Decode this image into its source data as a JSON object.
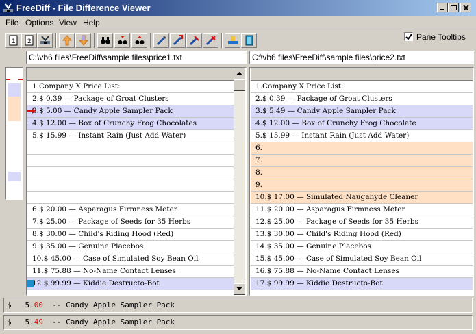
{
  "window": {
    "title": "FreeDiff - File Difference Viewer",
    "controls": {
      "minimize": "minimize-icon",
      "maximize": "maximize-icon",
      "close": "close-icon"
    }
  },
  "menu": [
    "File",
    "Options",
    "View",
    "Help"
  ],
  "toolbar": {
    "buttons": [
      "open-file-1-icon",
      "open-file-2-icon",
      "compare-icon",
      "prev-diff-icon",
      "next-diff-icon",
      "find-icon",
      "find-prev-icon",
      "find-next-icon",
      "tool-a-icon",
      "tool-b-icon",
      "tool-c-icon",
      "tool-d-icon",
      "clear-icon",
      "exit-icon"
    ],
    "pane_tooltips_label": "Pane Tooltips",
    "pane_tooltips_checked": true
  },
  "files": {
    "left_path": "C:\\vb6 files\\FreeDiff\\sample files\\price1.txt",
    "right_path": "C:\\vb6 files\\FreeDiff\\sample files\\price2.txt"
  },
  "colors": {
    "changed": "#d8d8f8",
    "added": "#ffe0c4",
    "marker": "#e01010",
    "accent": "#1890c8"
  },
  "left_pane": {
    "rows": [
      {
        "text": "1.Company X Price List:",
        "state": "same"
      },
      {
        "text": "2.$ 0.39 — Package of Groat Clusters",
        "state": "same"
      },
      {
        "text": "3.$ 5.00 — Candy Apple Sampler Pack",
        "state": "changed",
        "current": true
      },
      {
        "text": "4.$ 12.00 — Box of Crunchy Frog Chocolates",
        "state": "changed"
      },
      {
        "text": "5.$ 15.99 — Instant Rain (Just Add Water)",
        "state": "same"
      },
      {
        "text": "",
        "state": "blank"
      },
      {
        "text": "",
        "state": "blank"
      },
      {
        "text": "",
        "state": "blank"
      },
      {
        "text": "",
        "state": "blank"
      },
      {
        "text": "",
        "state": "blank"
      },
      {
        "text": "6.$ 20.00 — Asparagus Firmness Meter",
        "state": "same"
      },
      {
        "text": "7.$ 25.00 — Package of Seeds for 35 Herbs",
        "state": "same"
      },
      {
        "text": "8.$ 30.00 — Child's Riding Hood (Red)",
        "state": "same"
      },
      {
        "text": "9.$ 35.00 — Genuine Placebos",
        "state": "same"
      },
      {
        "text": "10.$ 45.00 — Case of Simulated Soy Bean Oil",
        "state": "same"
      },
      {
        "text": "11.$ 75.88 — No-Name Contact Lenses",
        "state": "same"
      },
      {
        "text": "12.$ 99.99 — Kiddie Destructo-Bot",
        "state": "changed",
        "mark": true
      }
    ]
  },
  "right_pane": {
    "rows": [
      {
        "text": "1.Company X Price List:",
        "state": "same"
      },
      {
        "text": "2.$ 0.39 — Package of Groat Clusters",
        "state": "same"
      },
      {
        "text": "3.$ 5.49 — Candy Apple Sampler Pack",
        "state": "changed"
      },
      {
        "text": "4.$ 12.00 — Box of Crunchy Frog Chocolate",
        "state": "changed"
      },
      {
        "text": "5.$ 15.99 — Instant Rain (Just Add Water)",
        "state": "same"
      },
      {
        "text": "6.",
        "state": "added"
      },
      {
        "text": "7.",
        "state": "added"
      },
      {
        "text": "8.",
        "state": "added"
      },
      {
        "text": "9.",
        "state": "added"
      },
      {
        "text": "10.$ 17.00 — Simulated Naugahyde Cleaner",
        "state": "added"
      },
      {
        "text": "11.$ 20.00 — Asparagus Firmness Meter",
        "state": "same"
      },
      {
        "text": "12.$ 25.00 — Package of Seeds for 35 Herbs",
        "state": "same"
      },
      {
        "text": "13.$ 30.00 — Child's Riding Hood (Red)",
        "state": "same"
      },
      {
        "text": "14.$ 35.00 — Genuine Placebos",
        "state": "same"
      },
      {
        "text": "15.$ 45.00 — Case of Simulated Soy Bean Oil",
        "state": "same"
      },
      {
        "text": "16.$ 75.88 — No-Name Contact Lenses",
        "state": "same"
      },
      {
        "text": "17.$ 99.99 — Kiddie Destructo-Bot",
        "state": "changed"
      }
    ]
  },
  "detail": {
    "line1": {
      "prefix": "$   5.",
      "diff": "00",
      "suffix": "  -- Candy Apple Sampler Pack"
    },
    "line2": {
      "prefix": "$   5.",
      "diff": "49",
      "suffix": "  -- Candy Apple Sampler Pack"
    }
  }
}
